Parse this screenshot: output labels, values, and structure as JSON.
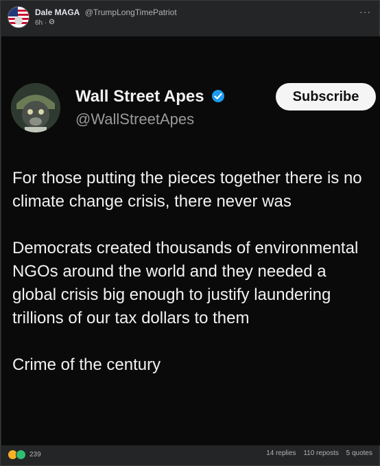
{
  "post": {
    "author_name": "Dale MAGA",
    "author_handle": "@TrumpLongTimePatriot",
    "time": "6h",
    "separator": "·",
    "more": "···"
  },
  "embedded": {
    "name": "Wall Street Apes",
    "handle": "@WallStreetApes",
    "subscribe_label": "Subscribe",
    "paragraphs": [
      "For those putting the pieces together there is no climate change crisis, there never was",
      "Democrats created thousands of environmental NGOs around the world and they needed a global crisis big enough to justify laundering trillions of our tax dollars to them",
      "Crime of the century"
    ]
  },
  "footer": {
    "reaction_count": "239",
    "replies": "14 replies",
    "reposts": "110 reposts",
    "quotes": "5 quotes"
  },
  "colors": {
    "background": "#242526",
    "screenshot_bg": "#0a0a0a",
    "verified": "#1d9bf0",
    "like": "#f7b125",
    "love": "#f33e58"
  }
}
